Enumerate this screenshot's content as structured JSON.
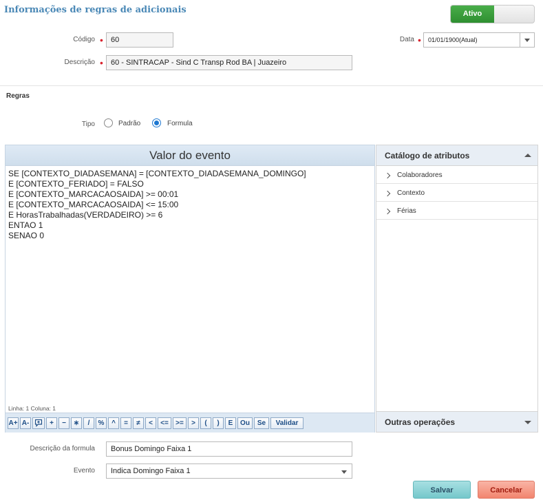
{
  "header": {
    "title": "Informações de regras de adicionais",
    "status_toggle": "Ativo"
  },
  "form": {
    "codigo_label": "Código",
    "codigo_value": "60",
    "descricao_label": "Descrição",
    "descricao_value": "60 - SINTRACAP - Sind C Transp Rod BA | Juazeiro",
    "data_label": "Data",
    "data_value": "01/01/1900(Atual)"
  },
  "regras": {
    "section_title": "Regras",
    "tipo_label": "Tipo",
    "options": [
      {
        "label": "Padrão",
        "selected": false
      },
      {
        "label": "Formula",
        "selected": true
      }
    ]
  },
  "editor": {
    "title": "Valor do evento",
    "lines": [
      "SE [CONTEXTO_DIADASEMANA] = [CONTEXTO_DIADASEMANA_DOMINGO]",
      "E [CONTEXTO_FERIADO] = FALSO",
      "E [CONTEXTO_MARCACAOSAIDA] >= 00:01",
      "E [CONTEXTO_MARCACAOSAIDA] <= 15:00",
      "E HorasTrabalhadas(VERDADEIRO) >= 6",
      "ENTAO 1",
      "SENAO 0"
    ],
    "status": "Linha: 1 Coluna: 1",
    "toolbar": [
      "A+",
      "A-",
      "☐",
      "+",
      "−",
      "∗",
      "/",
      "%",
      "^",
      "=",
      "≠",
      "<",
      "<=",
      ">=",
      ">",
      "(",
      ")",
      "E",
      "Ou",
      "Se",
      "Validar"
    ]
  },
  "catalog": {
    "title": "Catálogo de atributos",
    "items": [
      "Colaboradores",
      "Contexto",
      "Férias"
    ],
    "footer": "Outras operações"
  },
  "bottom": {
    "descricao_formula_label": "Descrição da formula",
    "descricao_formula_value": "Bonus Domingo Faixa 1",
    "evento_label": "Evento",
    "evento_value": "Indica Domingo Faixa 1"
  },
  "actions": {
    "save": "Salvar",
    "cancel": "Cancelar"
  },
  "colors": {
    "accent": "#4a88b6",
    "active_green": "#3a9d3c",
    "required": "#d9232e"
  }
}
